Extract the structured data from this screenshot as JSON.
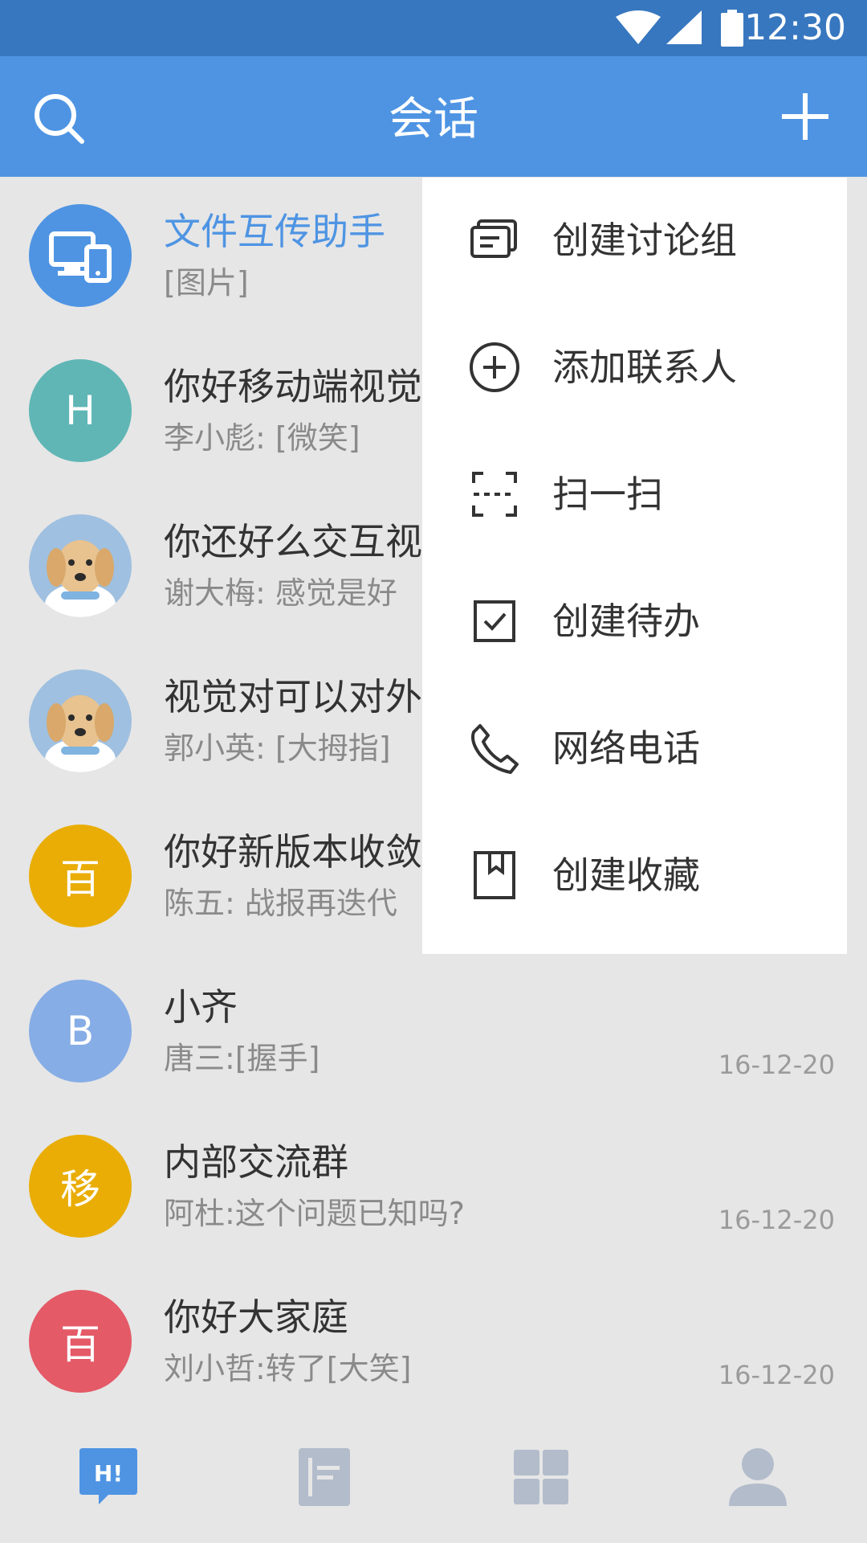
{
  "status_bar": {
    "time": "12:30",
    "icons": [
      "wifi-icon",
      "cell-signal-icon",
      "battery-icon"
    ]
  },
  "header": {
    "title": "会话",
    "left_icon": "search-icon",
    "right_icon": "plus-icon"
  },
  "colors": {
    "accent": "#4e94e3",
    "status_bar": "#3777bf",
    "background": "#e6e6e6"
  },
  "conversations": [
    {
      "name": "文件互传助手",
      "message": "[图片]",
      "date": "",
      "avatar_text": "",
      "avatar_color": "#4e94e3",
      "avatar_icon": "devices-icon"
    },
    {
      "name": "你好移动端视觉",
      "message": "李小彪: [微笑]",
      "date": "",
      "avatar_text": "H",
      "avatar_color": "#5fb6b5"
    },
    {
      "name": "你还好么交互视",
      "message": "谢大梅: 感觉是好",
      "date": "",
      "avatar_text": "",
      "avatar_color": "#9fc0e0",
      "avatar_icon": "puppy-photo"
    },
    {
      "name": "视觉对可以对外",
      "message": "郭小英: [大拇指]",
      "date": "",
      "avatar_text": "",
      "avatar_color": "#9fc0e0",
      "avatar_icon": "puppy-photo"
    },
    {
      "name": "你好新版本收敛",
      "message": "陈五: 战报再迭代",
      "date": "",
      "avatar_text": "百",
      "avatar_color": "#e9ad06"
    },
    {
      "name": "小齐",
      "message": "唐三:[握手]",
      "date": "16-12-20",
      "avatar_text": "B",
      "avatar_color": "#86ade6"
    },
    {
      "name": "内部交流群",
      "message": "阿杜:这个问题已知吗?",
      "date": "16-12-20",
      "avatar_text": "移",
      "avatar_color": "#e9ad06"
    },
    {
      "name": "你好大家庭",
      "message": "刘小哲:转了[大笑]",
      "date": "16-12-20",
      "avatar_text": "百",
      "avatar_color": "#e45a67"
    }
  ],
  "dropdown_menu": [
    {
      "label": "创建讨论组",
      "icon": "discussion-group-icon"
    },
    {
      "label": "添加联系人",
      "icon": "add-circle-icon"
    },
    {
      "label": "扫一扫",
      "icon": "scan-icon"
    },
    {
      "label": "创建待办",
      "icon": "checkbox-icon"
    },
    {
      "label": "网络电话",
      "icon": "phone-icon"
    },
    {
      "label": "创建收藏",
      "icon": "bookmark-icon"
    }
  ],
  "tab_bar": {
    "tabs": [
      {
        "icon": "chat-bubble-icon",
        "text": "H!",
        "active": true
      },
      {
        "icon": "document-icon",
        "active": false
      },
      {
        "icon": "apps-grid-icon",
        "active": false
      },
      {
        "icon": "person-icon",
        "active": false
      }
    ]
  }
}
